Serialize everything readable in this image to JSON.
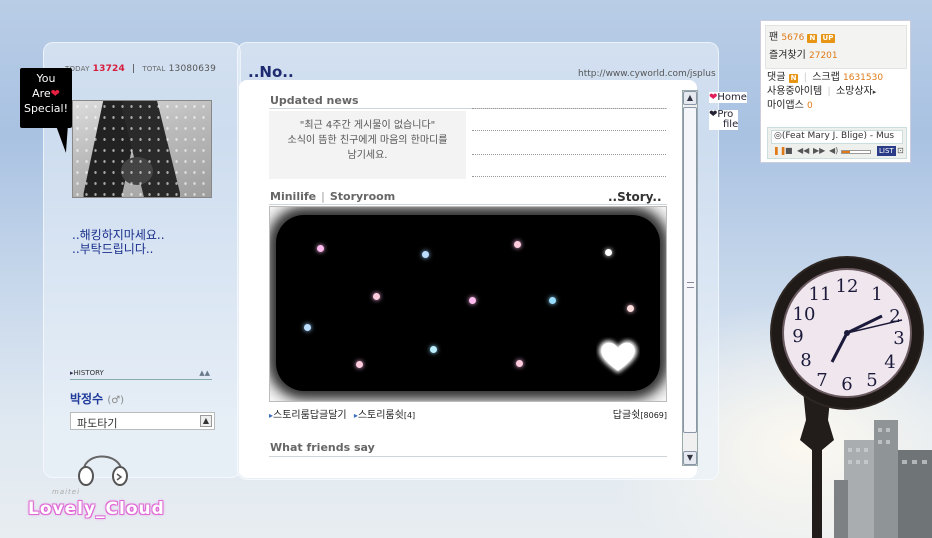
{
  "counter": {
    "today_label": "TODAY",
    "today": "13724",
    "separator": "|",
    "total_label": "TOTAL",
    "total": "13080639"
  },
  "badge_text": {
    "line1": "You",
    "line2": "Are",
    "heart": "❤",
    "line3": "Special!"
  },
  "profile": {
    "line1": "..해킹하지마세요..",
    "line2": "..부탁드립니다.."
  },
  "history": {
    "label": "HISTORY",
    "toggle": "▲▲"
  },
  "owner": {
    "name": "박정수",
    "gender": "(♂)"
  },
  "wave_select": {
    "value": "파도타기"
  },
  "signature": {
    "small": "maitei",
    "big": "Lovely_Cloud"
  },
  "main": {
    "title": "..No..",
    "url": "http://www.cyworld.com/jsplus"
  },
  "updated_news": {
    "title": "Updated news",
    "empty_line1": "\"최근 4주간 게시물이 없습니다\"",
    "empty_line2": "소식이 뜸한 친구에게 마음의 한마디를",
    "empty_line3": "남기세요."
  },
  "minilife": {
    "title1": "Minilife",
    "sep": "|",
    "title2": "Storyroom",
    "more": "..Story.."
  },
  "story_footer": {
    "link1": "스토리룸답글달기",
    "link2": "스토리룸쉿",
    "link2_count": "[4]",
    "reply_label": "답글쉿",
    "reply_count": "[8069]"
  },
  "friends": {
    "title": "What friends say"
  },
  "side_tabs": {
    "home": "Home",
    "profile_a": "Pro",
    "profile_b": "file"
  },
  "player": {
    "fan_label": "팬",
    "fan_count": "5676",
    "fan_badge": "N",
    "up_badge": "UP",
    "fav_label": "즐겨찾기",
    "fav_count": "27201",
    "reply_label": "댓글",
    "reply_badge": "N",
    "scrap_label": "스크랩",
    "scrap_count": "1631530",
    "items_label": "사용중아이템",
    "gift_label": "소망상자",
    "apps_label": "마이앱스",
    "apps_count": "0",
    "song": "(Feat Mary J. Blige) - Mus",
    "list_label": "LIST",
    "volume": 0.3
  },
  "colors": {
    "accent_red": "#d81b3a",
    "link_blue": "#1e3a9a",
    "orange": "#e07a18"
  }
}
